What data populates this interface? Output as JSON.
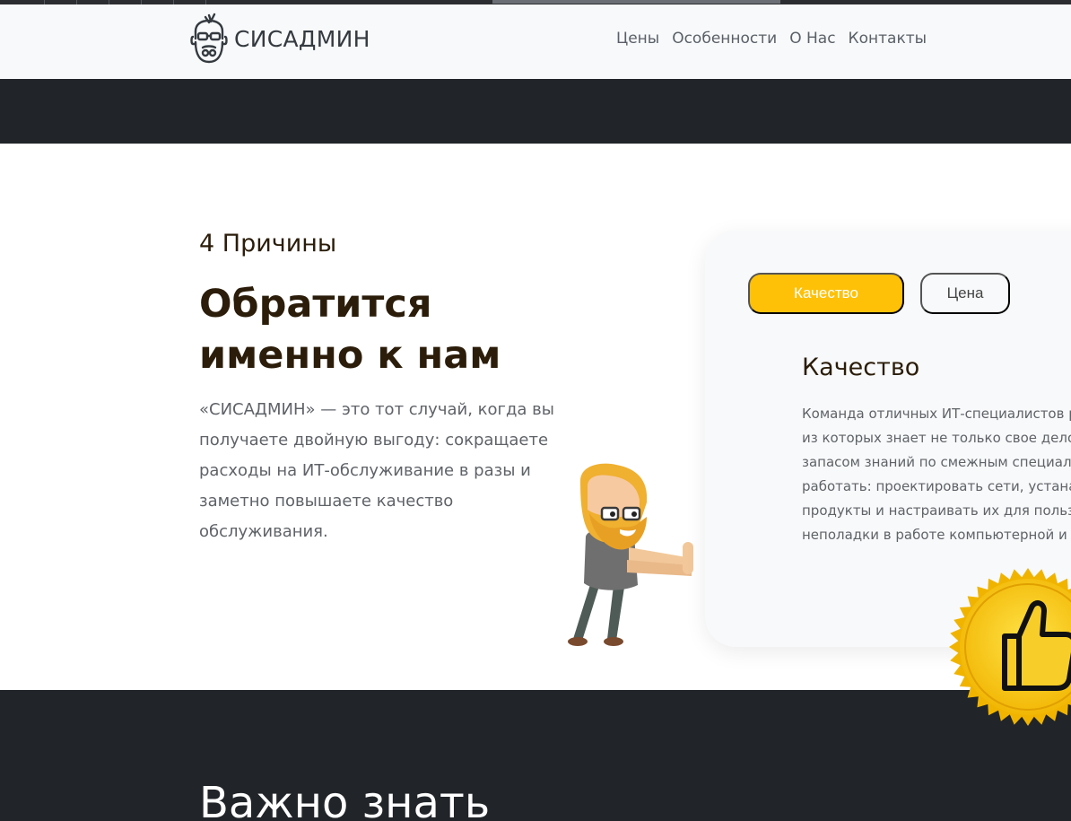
{
  "brand": {
    "name": "СИСАДМИН",
    "logo_icon": "bearded-admin-logo-icon"
  },
  "nav": {
    "items": [
      {
        "label": "Цены"
      },
      {
        "label": "Особенности"
      },
      {
        "label": "О Нас"
      },
      {
        "label": "Контакты"
      }
    ]
  },
  "reasons": {
    "kicker": "4 Причины",
    "headline_line1": "Обратится",
    "headline_line2": "именно к нам",
    "lead_lines": [
      "«СИСАДМИН» — это тот случай, когда вы",
      "получаете двойную выгоду: сокращаете",
      "расходы на ИТ-обслуживание в разы и",
      "заметно повышаете качество",
      "обслуживания."
    ]
  },
  "card": {
    "tabs": [
      {
        "label": "Качество",
        "active": true
      },
      {
        "label": "Цена",
        "active": false
      }
    ],
    "title": "Качество",
    "text_lines": [
      "Команда отличных ИТ-специалистов ра",
      "из которых знает не только свое дело, н",
      "запасом знаний по смежным специальн",
      "работать: проектировать сети, устанавл",
      "продукты и настраивать их для пользов",
      "неполадки в работе компьютерной и оф"
    ]
  },
  "badge": {
    "icon": "thumbs-up-icon"
  },
  "important": {
    "title": "Важно знать"
  },
  "colors": {
    "accent": "#ffc107",
    "dark": "#212529",
    "heading": "#2b1d0a",
    "navbar_bg": "#f8f9fa"
  }
}
